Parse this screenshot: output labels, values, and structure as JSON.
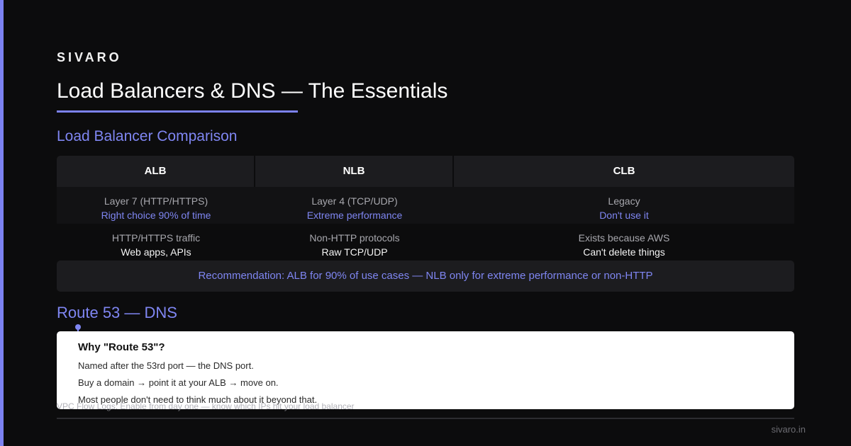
{
  "brand": "SIVARO",
  "page_title": "Load Balancers & DNS — The Essentials",
  "colors": {
    "accent": "#7c82f0",
    "background": "#0c0c0d",
    "card": "#ffffff"
  },
  "load_balancer": {
    "heading": "Load Balancer Comparison",
    "columns": [
      "ALB",
      "NLB",
      "CLB"
    ],
    "rows": [
      [
        {
          "primary": "Layer 7 (HTTP/HTTPS)",
          "secondary": "Right choice 90% of time"
        },
        {
          "primary": "Layer 4 (TCP/UDP)",
          "secondary": "Extreme performance"
        },
        {
          "primary": "Legacy",
          "secondary": "Don't use it"
        }
      ],
      [
        {
          "primary": "HTTP/HTTPS traffic",
          "secondary": "Web apps, APIs"
        },
        {
          "primary": "Non-HTTP protocols",
          "secondary": "Raw TCP/UDP"
        },
        {
          "primary": "Exists because AWS",
          "secondary": "Can't delete things"
        }
      ]
    ],
    "recommendation": "Recommendation: ALB for 90% of use cases — NLB only for extreme performance or non-HTTP"
  },
  "dns": {
    "heading": "Route 53 — DNS",
    "card_title": "Why \"Route 53\"?",
    "lines": [
      "Named after the 53rd port — the DNS port.",
      "Buy a domain → point it at your ALB → move on.",
      "Most people don't need to think much about it beyond that."
    ]
  },
  "footnote": "VPC Flow Logs: Enable from day one — know which IPs hit your load balancer",
  "footer_brand": "sivaro.in"
}
